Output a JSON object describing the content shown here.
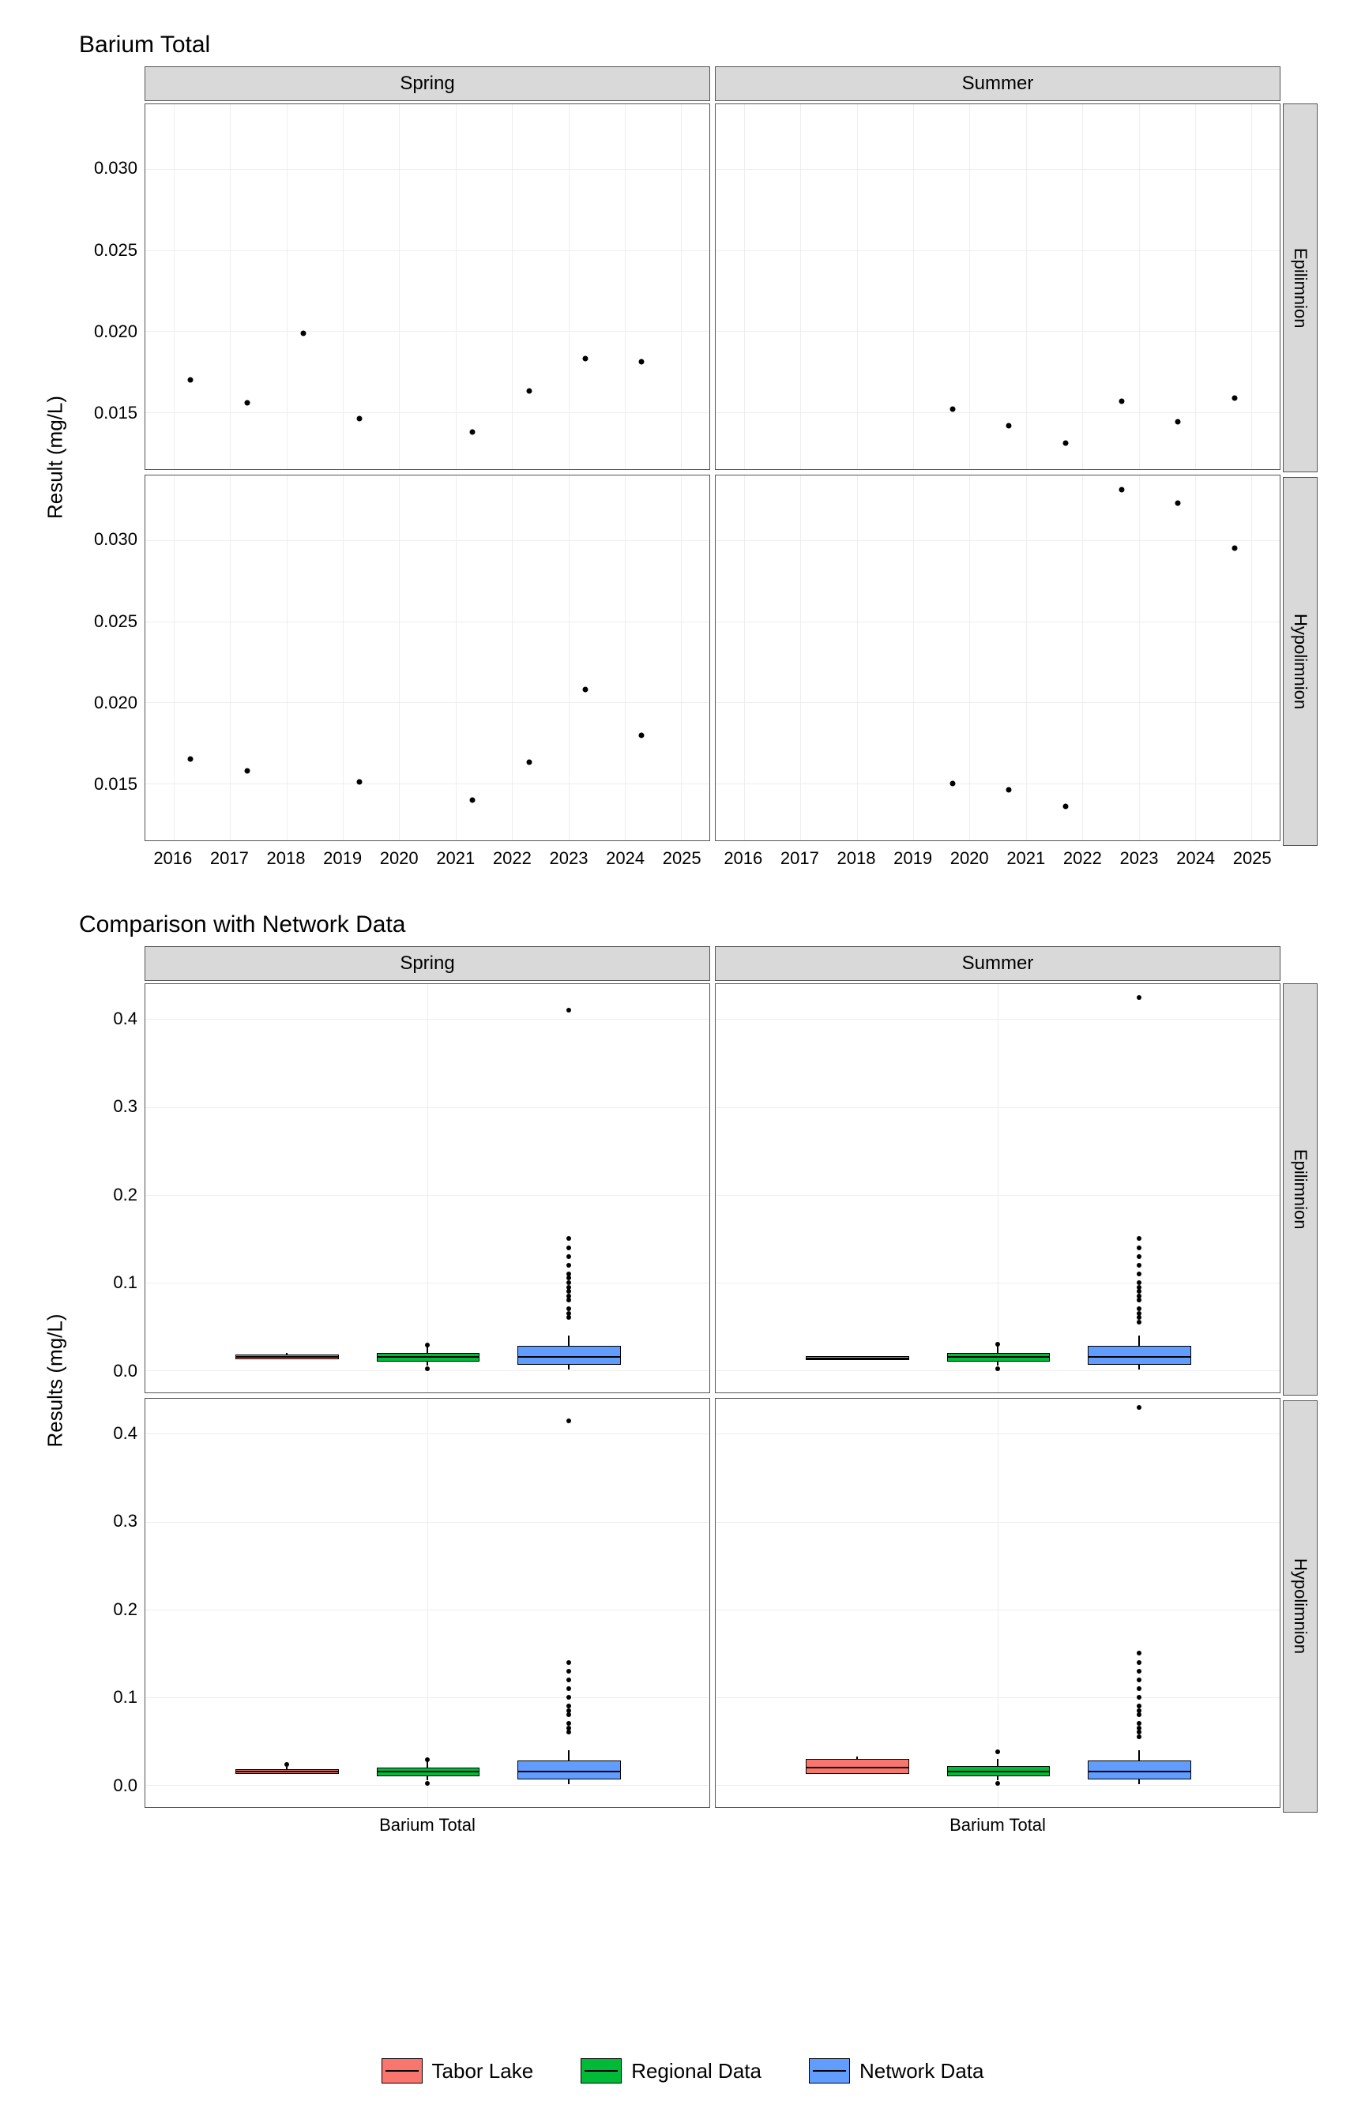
{
  "chart_data": [
    {
      "type": "scatter",
      "title": "Barium Total",
      "xlabel": "",
      "ylabel": "Result (mg/L)",
      "facet_cols": [
        "Spring",
        "Summer"
      ],
      "facet_rows": [
        "Epilimnion",
        "Hypolimnion"
      ],
      "xlim": [
        2015.5,
        2025.5
      ],
      "ylim": [
        0.0115,
        0.034
      ],
      "x_ticks": [
        2016,
        2017,
        2018,
        2019,
        2020,
        2021,
        2022,
        2023,
        2024,
        2025
      ],
      "y_ticks": [
        0.015,
        0.02,
        0.025,
        0.03
      ],
      "panels": {
        "Spring|Epilimnion": {
          "x": [
            2016.3,
            2017.3,
            2018.3,
            2019.3,
            2021.3,
            2022.3,
            2023.3,
            2024.3
          ],
          "y": [
            0.017,
            0.0156,
            0.0199,
            0.0146,
            0.0138,
            0.0163,
            0.0183,
            0.0181
          ]
        },
        "Summer|Epilimnion": {
          "x": [
            2019.7,
            2020.7,
            2021.7,
            2022.7,
            2023.7,
            2024.7
          ],
          "y": [
            0.0152,
            0.0142,
            0.0131,
            0.0157,
            0.0144,
            0.0159
          ]
        },
        "Spring|Hypolimnion": {
          "x": [
            2016.3,
            2017.3,
            2019.3,
            2021.3,
            2022.3,
            2023.3,
            2024.3
          ],
          "y": [
            0.0165,
            0.0158,
            0.0151,
            0.014,
            0.0163,
            0.0208,
            0.018
          ]
        },
        "Summer|Hypolimnion": {
          "x": [
            2019.7,
            2020.7,
            2021.7,
            2022.7,
            2023.7,
            2024.7
          ],
          "y": [
            0.015,
            0.0146,
            0.0136,
            0.0331,
            0.0323,
            0.0295
          ]
        }
      }
    },
    {
      "type": "box",
      "title": "Comparison with Network Data",
      "xlabel": "",
      "ylabel": "Results (mg/L)",
      "facet_cols": [
        "Spring",
        "Summer"
      ],
      "facet_rows": [
        "Epilimnion",
        "Hypolimnion"
      ],
      "ylim": [
        -0.025,
        0.44
      ],
      "y_ticks": [
        0.0,
        0.1,
        0.2,
        0.3,
        0.4
      ],
      "x_category": "Barium Total",
      "series": [
        {
          "name": "Tabor Lake",
          "color": "#f8766d"
        },
        {
          "name": "Regional Data",
          "color": "#00ba38"
        },
        {
          "name": "Network Data",
          "color": "#619cff"
        }
      ],
      "panels": {
        "Spring|Epilimnion": {
          "boxes": [
            {
              "series": "Tabor Lake",
              "q1": 0.0145,
              "med": 0.016,
              "q3": 0.018,
              "lw": 0.014,
              "uw": 0.02,
              "out": []
            },
            {
              "series": "Regional Data",
              "q1": 0.012,
              "med": 0.016,
              "q3": 0.02,
              "lw": 0.006,
              "uw": 0.028,
              "out": [
                0.002,
                0.029
              ]
            },
            {
              "series": "Network Data",
              "q1": 0.008,
              "med": 0.016,
              "q3": 0.028,
              "lw": 0.001,
              "uw": 0.04,
              "out": [
                0.06,
                0.065,
                0.07,
                0.08,
                0.085,
                0.09,
                0.095,
                0.1,
                0.105,
                0.11,
                0.12,
                0.13,
                0.14,
                0.15,
                0.41
              ]
            }
          ]
        },
        "Summer|Epilimnion": {
          "boxes": [
            {
              "series": "Tabor Lake",
              "q1": 0.014,
              "med": 0.015,
              "q3": 0.016,
              "lw": 0.013,
              "uw": 0.016,
              "out": []
            },
            {
              "series": "Regional Data",
              "q1": 0.012,
              "med": 0.016,
              "q3": 0.02,
              "lw": 0.006,
              "uw": 0.028,
              "out": [
                0.002,
                0.03
              ]
            },
            {
              "series": "Network Data",
              "q1": 0.008,
              "med": 0.016,
              "q3": 0.028,
              "lw": 0.001,
              "uw": 0.04,
              "out": [
                0.055,
                0.06,
                0.065,
                0.07,
                0.08,
                0.085,
                0.09,
                0.095,
                0.1,
                0.11,
                0.12,
                0.13,
                0.14,
                0.15,
                0.425
              ]
            }
          ]
        },
        "Spring|Hypolimnion": {
          "boxes": [
            {
              "series": "Tabor Lake",
              "q1": 0.015,
              "med": 0.016,
              "q3": 0.018,
              "lw": 0.014,
              "uw": 0.021,
              "out": [
                0.024
              ]
            },
            {
              "series": "Regional Data",
              "q1": 0.012,
              "med": 0.016,
              "q3": 0.02,
              "lw": 0.006,
              "uw": 0.028,
              "out": [
                0.002,
                0.029
              ]
            },
            {
              "series": "Network Data",
              "q1": 0.008,
              "med": 0.016,
              "q3": 0.028,
              "lw": 0.001,
              "uw": 0.04,
              "out": [
                0.06,
                0.065,
                0.07,
                0.08,
                0.085,
                0.09,
                0.1,
                0.11,
                0.12,
                0.13,
                0.14,
                0.415
              ]
            }
          ]
        },
        "Summer|Hypolimnion": {
          "boxes": [
            {
              "series": "Tabor Lake",
              "q1": 0.015,
              "med": 0.021,
              "q3": 0.03,
              "lw": 0.014,
              "uw": 0.033,
              "out": []
            },
            {
              "series": "Regional Data",
              "q1": 0.012,
              "med": 0.016,
              "q3": 0.022,
              "lw": 0.006,
              "uw": 0.03,
              "out": [
                0.002,
                0.038
              ]
            },
            {
              "series": "Network Data",
              "q1": 0.008,
              "med": 0.016,
              "q3": 0.028,
              "lw": 0.001,
              "uw": 0.04,
              "out": [
                0.055,
                0.06,
                0.065,
                0.07,
                0.08,
                0.085,
                0.09,
                0.1,
                0.11,
                0.12,
                0.13,
                0.14,
                0.15,
                0.43
              ]
            }
          ]
        }
      }
    }
  ],
  "titles": {
    "top": "Barium Total",
    "bottom": "Comparison with Network Data"
  },
  "axis": {
    "top_y": "Result (mg/L)",
    "bottom_y": "Results (mg/L)",
    "bottom_x": "Barium Total"
  },
  "legend": {
    "a": "Tabor Lake",
    "b": "Regional Data",
    "c": "Network Data"
  }
}
